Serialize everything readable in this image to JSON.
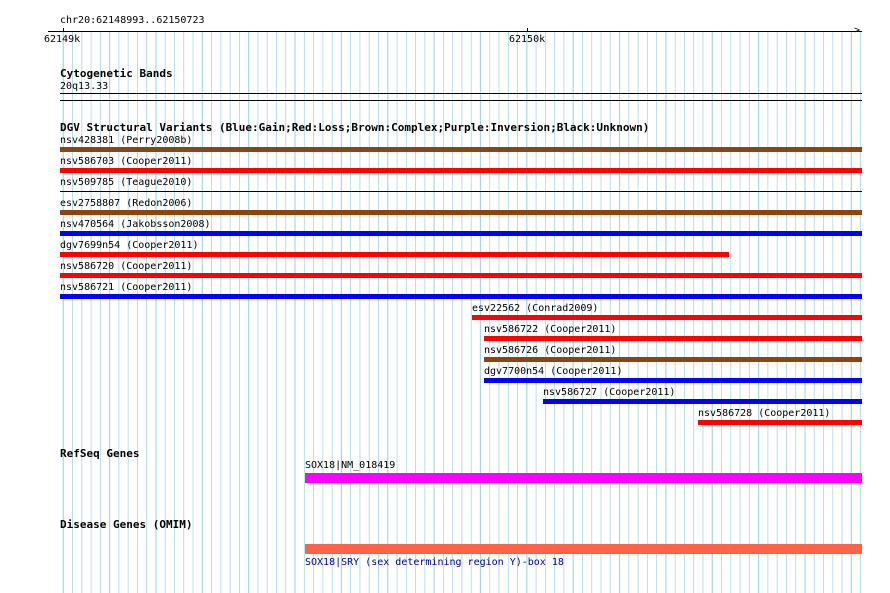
{
  "ruler": {
    "region": "chr20:62148993..62150723",
    "start": 62148993,
    "end": 62150723,
    "tick_labels": [
      {
        "label": "62149k",
        "pos": 62149000
      },
      {
        "label": "62150k",
        "pos": 62150000
      }
    ]
  },
  "colors": {
    "gain": "#0000ff",
    "loss": "#ff0000",
    "complex": "#8b4513",
    "inversion": "#800080",
    "unknown": "#000000",
    "grid": "#a8d8e0",
    "refseq": "#ff00ff",
    "omim": "#ff6347"
  },
  "cytoband": {
    "title": "Cytogenetic Bands",
    "band": "20q13.33"
  },
  "dgv": {
    "title": "DGV Structural Variants (Blue:Gain;Red:Loss;Brown:Complex;Purple:Inversion;Black:Unknown)",
    "variants": [
      {
        "label": "nsv428381 (Perry2008b)",
        "type": "complex",
        "start": 62148993,
        "end": 62150723
      },
      {
        "label": "nsv586703 (Cooper2011)",
        "type": "loss",
        "start": 62148993,
        "end": 62150723
      },
      {
        "label": "nsv509785 (Teague2010)",
        "type": "unknown",
        "start": 62148993,
        "end": 62150723
      },
      {
        "label": "esv2758807 (Redon2006)",
        "type": "complex",
        "start": 62148993,
        "end": 62150723
      },
      {
        "label": "nsv470564 (Jakobsson2008)",
        "type": "gain",
        "start": 62148993,
        "end": 62150723
      },
      {
        "label": "dgv7699n54 (Cooper2011)",
        "type": "loss",
        "start": 62148993,
        "end": 62150436
      },
      {
        "label": "nsv586720 (Cooper2011)",
        "type": "loss",
        "start": 62148993,
        "end": 62150723
      },
      {
        "label": "nsv586721 (Cooper2011)",
        "type": "gain",
        "start": 62148993,
        "end": 62150723
      },
      {
        "label": "esv22562 (Conrad2009)",
        "type": "loss",
        "start": 62149882,
        "end": 62150723
      },
      {
        "label": "nsv586722 (Cooper2011)",
        "type": "loss",
        "start": 62149908,
        "end": 62150723
      },
      {
        "label": "nsv586726 (Cooper2011)",
        "type": "complex",
        "start": 62149908,
        "end": 62150723
      },
      {
        "label": "dgv7700n54 (Cooper2011)",
        "type": "gain",
        "start": 62149908,
        "end": 62150723
      },
      {
        "label": "nsv586727 (Cooper2011)",
        "type": "gain",
        "start": 62150035,
        "end": 62150723
      },
      {
        "label": "nsv586728 (Cooper2011)",
        "type": "loss",
        "start": 62150370,
        "end": 62150723
      }
    ]
  },
  "refseq": {
    "title": "RefSeq Genes",
    "genes": [
      {
        "label": "SOX18|NM_018419",
        "start": 62149521,
        "end": 62150723
      }
    ]
  },
  "omim": {
    "title": "Disease Genes (OMIM)",
    "genes": [
      {
        "label": "SOX18|SRY (sex determining region Y)-box 18",
        "start": 62149521,
        "end": 62150723
      }
    ]
  }
}
